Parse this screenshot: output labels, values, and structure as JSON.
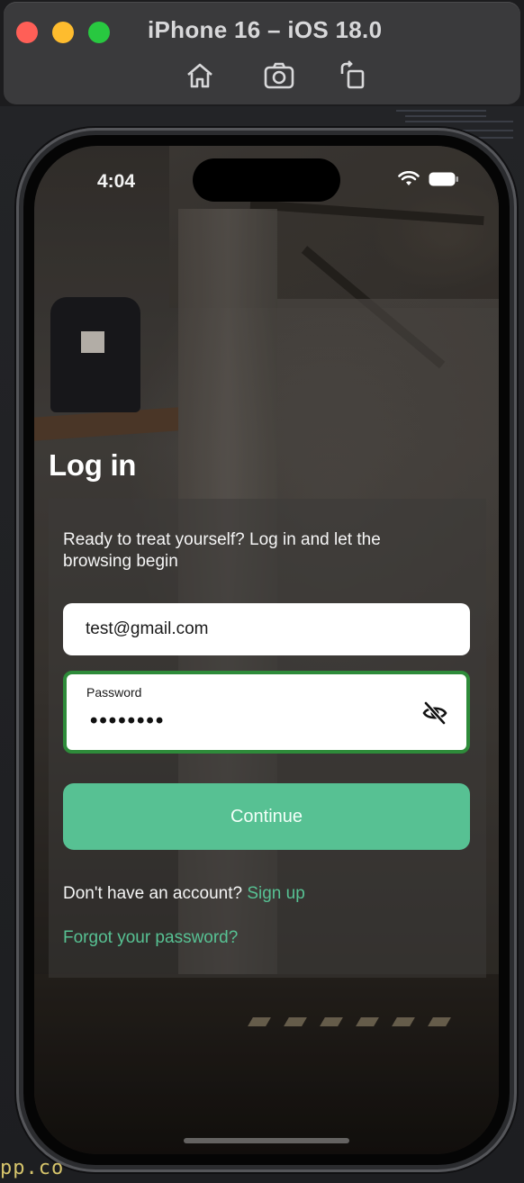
{
  "simulator": {
    "title": "iPhone 16 – iOS 18.0",
    "tools": [
      {
        "icon": "home-icon"
      },
      {
        "icon": "screenshot-icon"
      },
      {
        "icon": "rotate-icon"
      }
    ]
  },
  "status_bar": {
    "time": "4:04",
    "icons": [
      "wifi-icon",
      "battery-icon"
    ]
  },
  "login": {
    "title": "Log in",
    "subtitle": "Ready to treat yourself? Log in and let the browsing begin",
    "email_value": "test@gmail.com",
    "password_label": "Password",
    "password_value": "••••••••",
    "password_toggle_icon": "eye-off-icon",
    "continue_label": "Continue",
    "signup_prompt": "Don't have an account? ",
    "signup_link": "Sign up",
    "forgot_link": "Forgot your password?"
  },
  "colors": {
    "accent": "#57c193",
    "focus_border": "#2e8b3a",
    "traffic_red": "#ff5f57",
    "traffic_yellow": "#febc2e",
    "traffic_green": "#28c840"
  },
  "background_snippet": "pp.co"
}
